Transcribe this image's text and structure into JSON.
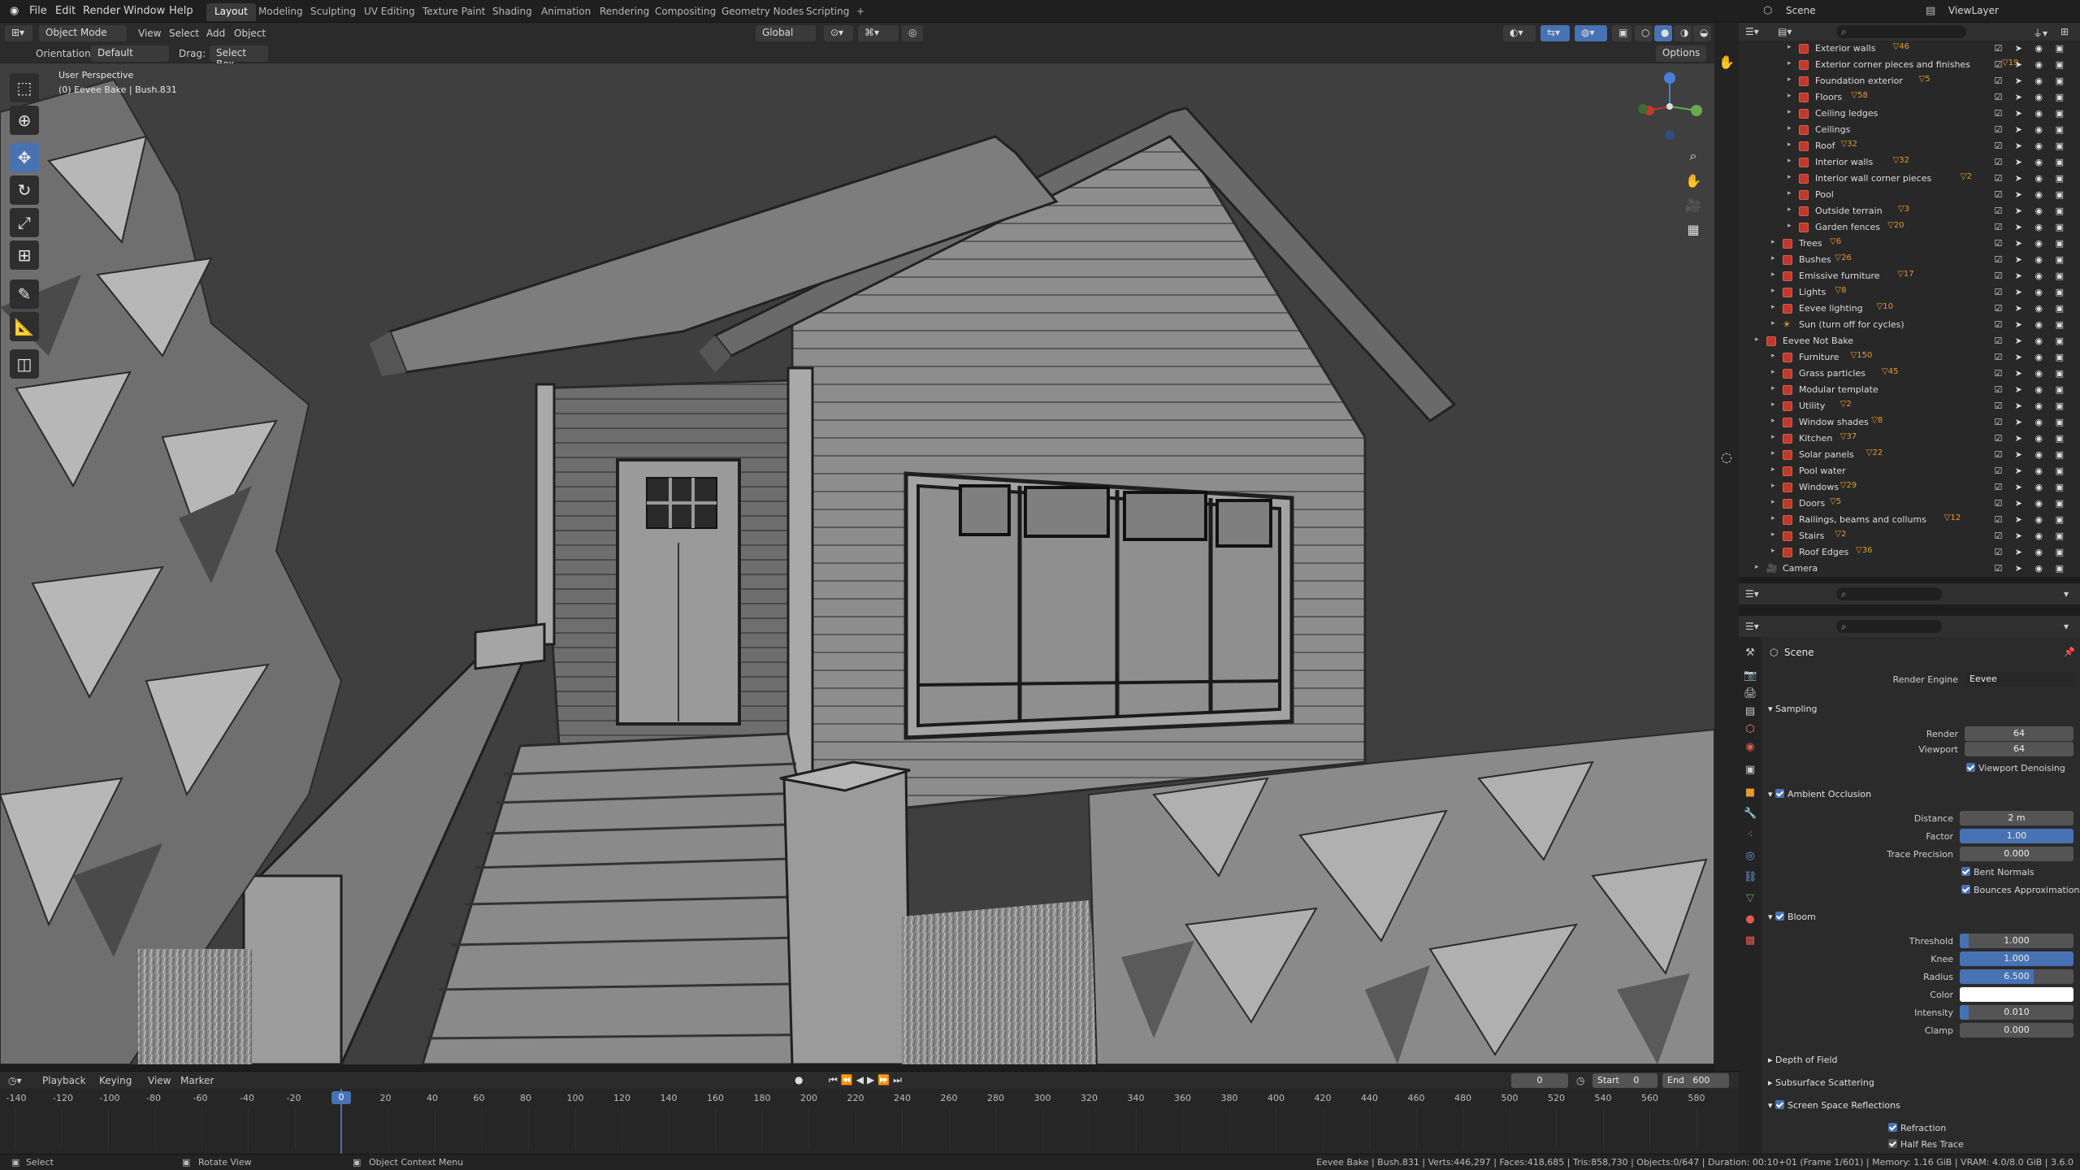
{
  "app": {
    "menus": [
      "File",
      "Edit",
      "Render",
      "Window",
      "Help"
    ],
    "workspaces": [
      "Layout",
      "Modeling",
      "Sculpting",
      "UV Editing",
      "Texture Paint",
      "Shading",
      "Animation",
      "Rendering",
      "Compositing",
      "Geometry Nodes",
      "Scripting",
      "+"
    ],
    "active_workspace": "Layout",
    "scene_name": "Scene",
    "view_layer": "ViewLayer"
  },
  "viewport_header": {
    "mode": "Object Mode",
    "menus": [
      "View",
      "Select",
      "Add",
      "Object"
    ],
    "transform_orientation": "Global",
    "orientation_label": "Orientation:",
    "orientation_value": "Default",
    "drag_label": "Drag:",
    "drag_value": "Select Box",
    "options": "Options"
  },
  "viewport": {
    "perspective": "User Perspective",
    "object_info": "(0) Eevee Bake | Bush.831"
  },
  "outliner": {
    "items": [
      {
        "label": "Exterior walls",
        "indent": 3,
        "count": "46"
      },
      {
        "label": "Exterior corner pieces and finishes",
        "indent": 3,
        "count": "19"
      },
      {
        "label": "Foundation exterior",
        "indent": 3,
        "count": "5"
      },
      {
        "label": "Floors",
        "indent": 3,
        "count": "58"
      },
      {
        "label": "Ceiling ledges",
        "indent": 3,
        "count": ""
      },
      {
        "label": "Ceilings",
        "indent": 3,
        "count": ""
      },
      {
        "label": "Roof",
        "indent": 3,
        "count": "32"
      },
      {
        "label": "Interior walls",
        "indent": 3,
        "count": "32"
      },
      {
        "label": "Interior wall corner pieces",
        "indent": 3,
        "count": "2"
      },
      {
        "label": "Pool",
        "indent": 3,
        "count": ""
      },
      {
        "label": "Outside terrain",
        "indent": 3,
        "count": "3"
      },
      {
        "label": "Garden fences",
        "indent": 3,
        "count": "20"
      },
      {
        "label": "Trees",
        "indent": 2,
        "count": "6"
      },
      {
        "label": "Bushes",
        "indent": 2,
        "count": "26"
      },
      {
        "label": "Emissive furniture",
        "indent": 2,
        "count": "17"
      },
      {
        "label": "Lights",
        "indent": 2,
        "count": "8"
      },
      {
        "label": "Eevee lighting",
        "indent": 2,
        "count": "10"
      },
      {
        "label": "Sun (turn off for cycles)",
        "indent": 2,
        "count": ""
      },
      {
        "label": "Eevee Not Bake",
        "indent": 1,
        "count": ""
      },
      {
        "label": "Furniture",
        "indent": 2,
        "count": "150"
      },
      {
        "label": "Grass particles",
        "indent": 2,
        "count": "45"
      },
      {
        "label": "Modular template",
        "indent": 2,
        "count": ""
      },
      {
        "label": "Utility",
        "indent": 2,
        "count": "2"
      },
      {
        "label": "Window shades",
        "indent": 2,
        "count": "8"
      },
      {
        "label": "Kitchen",
        "indent": 2,
        "count": "37"
      },
      {
        "label": "Solar panels",
        "indent": 2,
        "count": "22"
      },
      {
        "label": "Pool water",
        "indent": 2,
        "count": ""
      },
      {
        "label": "Windows",
        "indent": 2,
        "count": "29"
      },
      {
        "label": "Doors",
        "indent": 2,
        "count": "5"
      },
      {
        "label": "Railings, beams and collums",
        "indent": 2,
        "count": "12"
      },
      {
        "label": "Stairs",
        "indent": 2,
        "count": "2"
      },
      {
        "label": "Roof Edges",
        "indent": 2,
        "count": "36"
      },
      {
        "label": "Camera",
        "indent": 1,
        "count": ""
      }
    ]
  },
  "properties": {
    "context": "Scene",
    "render_engine_label": "Render Engine",
    "render_engine": "Eevee",
    "sampling": {
      "title": "Sampling",
      "render_label": "Render",
      "render": "64",
      "viewport_label": "Viewport",
      "viewport": "64",
      "denoise": "Viewport Denoising"
    },
    "ao": {
      "title": "Ambient Occlusion",
      "distance_label": "Distance",
      "distance": "2 m",
      "factor_label": "Factor",
      "factor": "1.00",
      "trace_label": "Trace Precision",
      "trace": "0.000",
      "bent": "Bent Normals",
      "bounces": "Bounces Approximation"
    },
    "bloom": {
      "title": "Bloom",
      "threshold_label": "Threshold",
      "threshold": "1.000",
      "knee_label": "Knee",
      "knee": "1.000",
      "radius_label": "Radius",
      "radius": "6.500",
      "color_label": "Color",
      "intensity_label": "Intensity",
      "intensity": "0.010",
      "clamp_label": "Clamp",
      "clamp": "0.000"
    },
    "sections": [
      "Depth of Field",
      "Subsurface Scattering",
      "Screen Space Reflections"
    ],
    "refraction": "Refraction",
    "half_res": "Half Res Trace"
  },
  "timeline": {
    "menus": [
      "Playback",
      "Keying",
      "View",
      "Marker"
    ],
    "current_frame": "0",
    "start_label": "Start",
    "start": "0",
    "end_label": "End",
    "end": "600",
    "ticks": [
      "-140",
      "-120",
      "-100",
      "-80",
      "-60",
      "-40",
      "-20",
      "0",
      "20",
      "40",
      "60",
      "80",
      "100",
      "120",
      "140",
      "160",
      "180",
      "200",
      "220",
      "240",
      "260",
      "280",
      "300",
      "320",
      "340",
      "360",
      "380",
      "400",
      "420",
      "440",
      "460",
      "480",
      "500",
      "520",
      "540",
      "560",
      "580"
    ]
  },
  "statusbar": {
    "select": "Select",
    "rotate": "Rotate View",
    "context": "Object Context Menu",
    "stats": "Eevee Bake | Bush.831 | Verts:446,297 | Faces:418,685 | Tris:858,730 | Objects:0/647 | Duration: 00:10+01 (Frame 1/601) | Memory: 1.16 GiB | VRAM: 4.0/8.0 GiB | 3.6.0"
  }
}
